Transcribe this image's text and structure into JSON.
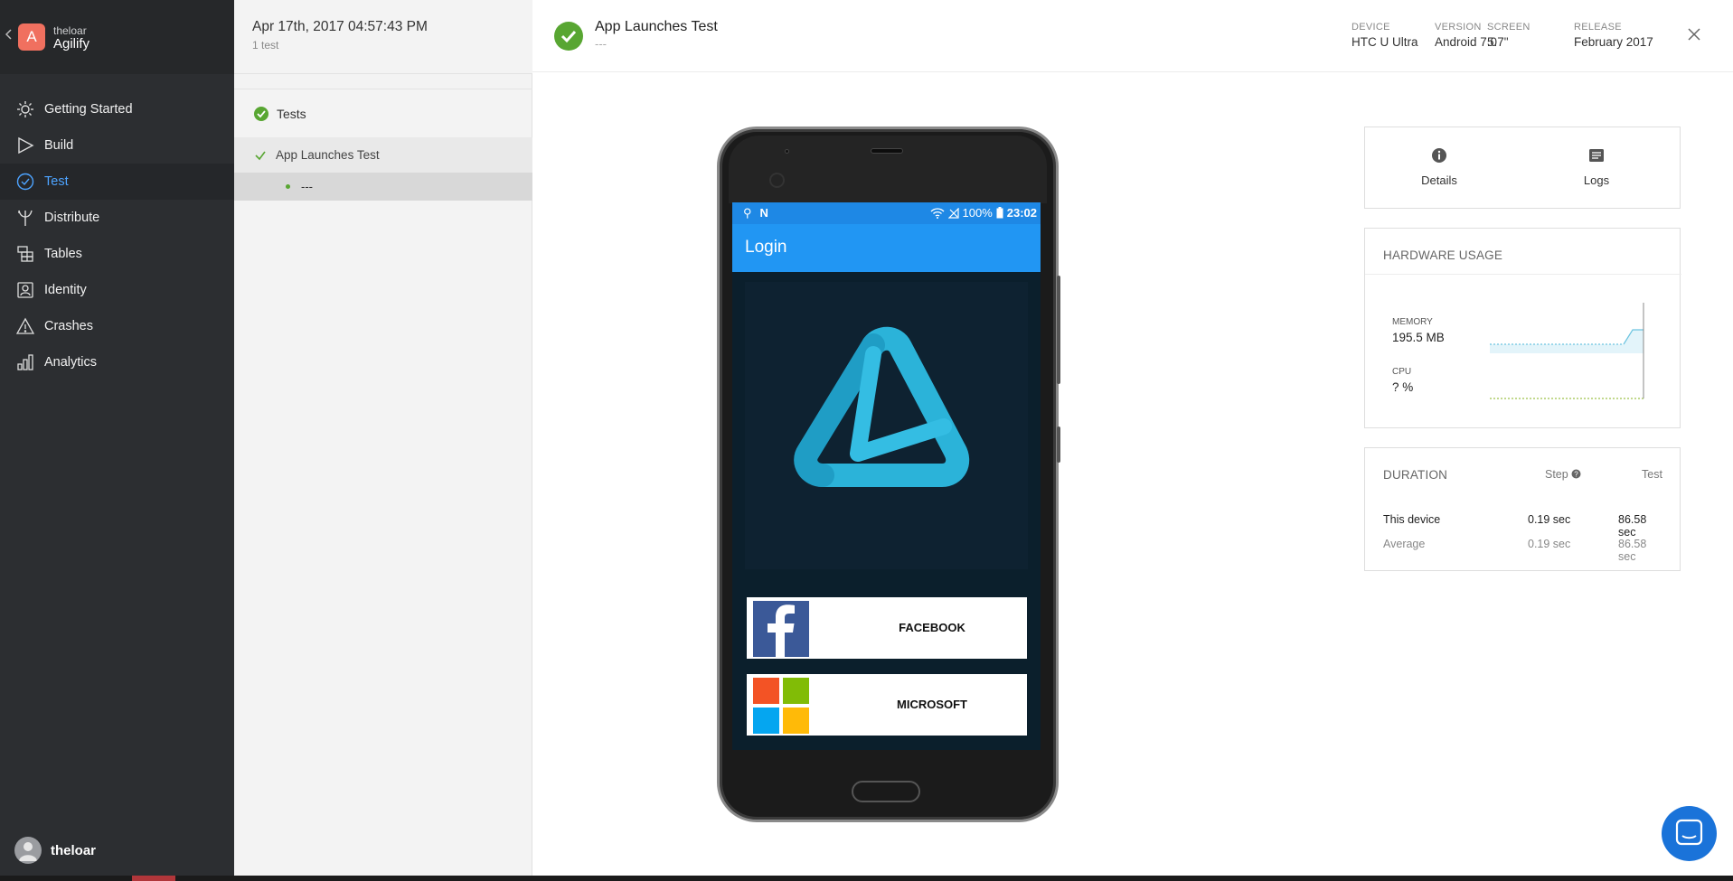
{
  "sidebar": {
    "org": "theloar",
    "app": "Agilify",
    "app_initial": "A",
    "items": [
      {
        "label": "Getting Started",
        "icon": "sun-icon"
      },
      {
        "label": "Build",
        "icon": "play-icon"
      },
      {
        "label": "Test",
        "icon": "check-circle-icon",
        "active": true
      },
      {
        "label": "Distribute",
        "icon": "fork-icon"
      },
      {
        "label": "Tables",
        "icon": "table-icon"
      },
      {
        "label": "Identity",
        "icon": "id-card-icon"
      },
      {
        "label": "Crashes",
        "icon": "warning-icon"
      },
      {
        "label": "Analytics",
        "icon": "bar-chart-icon"
      }
    ],
    "user": "theloar"
  },
  "tests_panel": {
    "date": "Apr 17th, 2017 04:57:43 PM",
    "count": "1 test",
    "group": "Tests",
    "test": "App Launches Test",
    "step": "---"
  },
  "header": {
    "title": "App Launches Test",
    "subtitle": "---",
    "meta": [
      {
        "key": "DEVICE",
        "value": "HTC U Ultra"
      },
      {
        "key": "VERSION",
        "value": "Android 7.0"
      },
      {
        "key": "SCREEN",
        "value": "5.7\""
      },
      {
        "key": "RELEASE",
        "value": "February 2017"
      }
    ]
  },
  "phone": {
    "battery": "100%",
    "time": "23:02",
    "app_title": "Login",
    "facebook": "FACEBOOK",
    "microsoft": "MICROSOFT"
  },
  "tabs": {
    "details": "Details",
    "logs": "Logs"
  },
  "hardware": {
    "title": "HARDWARE USAGE",
    "memory_label": "MEMORY",
    "memory_value": "195.5 MB",
    "cpu_label": "CPU",
    "cpu_value": "? %"
  },
  "duration": {
    "title": "DURATION",
    "col_step": "Step",
    "col_test": "Test",
    "rows": [
      {
        "label": "This device",
        "step": "0.19 sec",
        "test": "86.58 sec"
      },
      {
        "label": "Average",
        "step": "0.19 sec",
        "test": "86.58 sec"
      }
    ]
  },
  "colors": {
    "sidebar_bg": "#2c2e31",
    "accent_blue": "#4da3ff",
    "success_green": "#58a632",
    "app_bar_blue": "#2196f3"
  }
}
